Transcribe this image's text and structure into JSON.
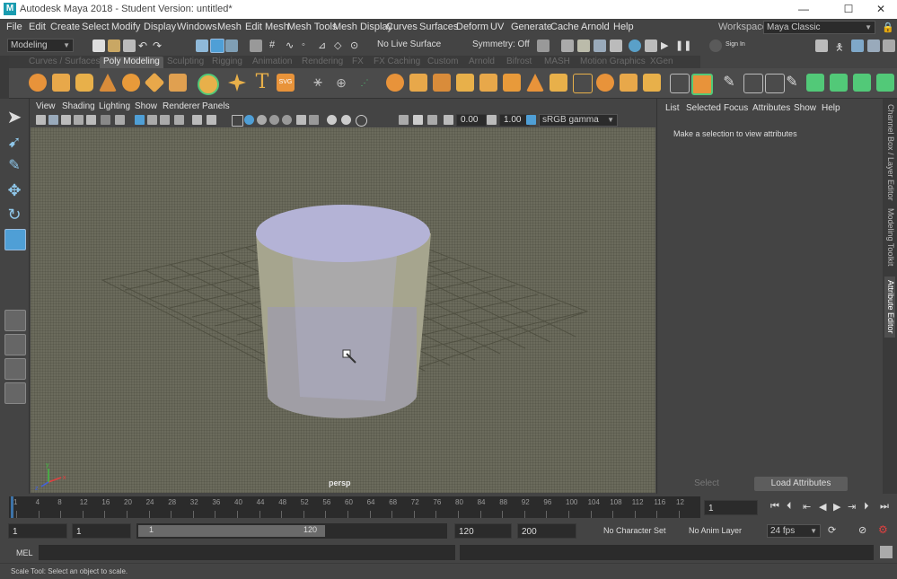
{
  "app": {
    "title": "Autodesk Maya 2018 - Student Version: untitled*",
    "logo_letter": "M",
    "window_buttons": {
      "minimize": "—",
      "maximize": "☐",
      "close": "✕"
    }
  },
  "menubar": {
    "items": [
      "File",
      "Edit",
      "Create",
      "Select",
      "Modify",
      "Display",
      "Windows",
      "Mesh",
      "Edit Mesh",
      "Mesh Tools",
      "Mesh Display",
      "Curves",
      "Surfaces",
      "Deform",
      "UV",
      "Generate",
      "Cache",
      "Arnold",
      "Help"
    ],
    "workspace_label": "Workspace :",
    "workspace_value": "Maya Classic"
  },
  "statusline": {
    "menuset": "Modeling",
    "live_surface": "No Live Surface",
    "symmetry": "Symmetry: Off",
    "signin": "Sign In"
  },
  "shelf": {
    "tabs": [
      "Curves / Surfaces",
      "Poly Modeling",
      "Sculpting",
      "Rigging",
      "Animation",
      "Rendering",
      "FX",
      "FX Caching",
      "Custom",
      "Arnold",
      "Bifrost",
      "MASH",
      "Motion Graphics",
      "XGen"
    ],
    "active_tab": "Poly Modeling"
  },
  "viewport": {
    "menu": [
      "View",
      "Shading",
      "Lighting",
      "Show",
      "Renderer",
      "Panels"
    ],
    "exposure": "0.00",
    "gamma": "1.00",
    "colorspace": "sRGB gamma",
    "camera_label": "persp",
    "axis_labels": {
      "x": "x",
      "y": "y",
      "z": "z"
    }
  },
  "attribute_editor": {
    "menu": [
      "List",
      "Selected",
      "Focus",
      "Attributes",
      "Show",
      "Help"
    ],
    "message": "Make a selection to view attributes",
    "select_button": "Select",
    "load_button": "Load Attributes",
    "side_tabs": [
      "Channel Box / Layer Editor",
      "Modeling Toolkit",
      "Attribute Editor"
    ]
  },
  "timeline": {
    "ticks": [
      "1",
      "4",
      "8",
      "12",
      "16",
      "20",
      "24",
      "28",
      "32",
      "36",
      "40",
      "44",
      "48",
      "52",
      "56",
      "60",
      "64",
      "68",
      "72",
      "76",
      "80",
      "84",
      "88",
      "92",
      "96",
      "100",
      "104",
      "108",
      "112",
      "116",
      "12"
    ],
    "current_frame": "1"
  },
  "range": {
    "start": "1",
    "playback_start": "1",
    "range_start_label": "1",
    "range_end_label": "120",
    "playback_end": "120",
    "end": "200",
    "character_set": "No Character Set",
    "anim_layer": "No Anim Layer",
    "fps": "24 fps"
  },
  "command_line": {
    "label": "MEL"
  },
  "help_line": {
    "text": "Scale Tool: Select an object to scale."
  },
  "colors": {
    "accent": "#4f9fd6",
    "shelf_yellow": "#e8b04a",
    "shelf_green": "#52c978",
    "shelf_orange": "#d97a2b",
    "viewport_bg": "#6b6b5c",
    "cylinder_top": "#b4b3d6",
    "maya_teal": "#1a9cb0"
  }
}
